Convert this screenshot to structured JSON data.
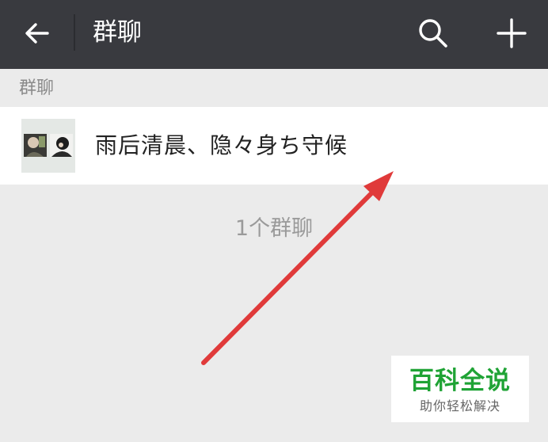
{
  "header": {
    "title": "群聊",
    "back_icon": "arrow-left-icon",
    "search_icon": "search-icon",
    "add_icon": "plus-icon",
    "background": "#393a3f"
  },
  "section": {
    "label": "群聊"
  },
  "groups": [
    {
      "name": "雨后清晨、隐々身ち守候",
      "avatar": "group-avatar"
    }
  ],
  "footer": {
    "count_text": "1个群聊"
  },
  "annotation": {
    "arrow_color": "#e03a3a"
  },
  "watermark": {
    "title": "百科全说",
    "subtitle": "助你轻松解决",
    "color": "#1fa335"
  }
}
